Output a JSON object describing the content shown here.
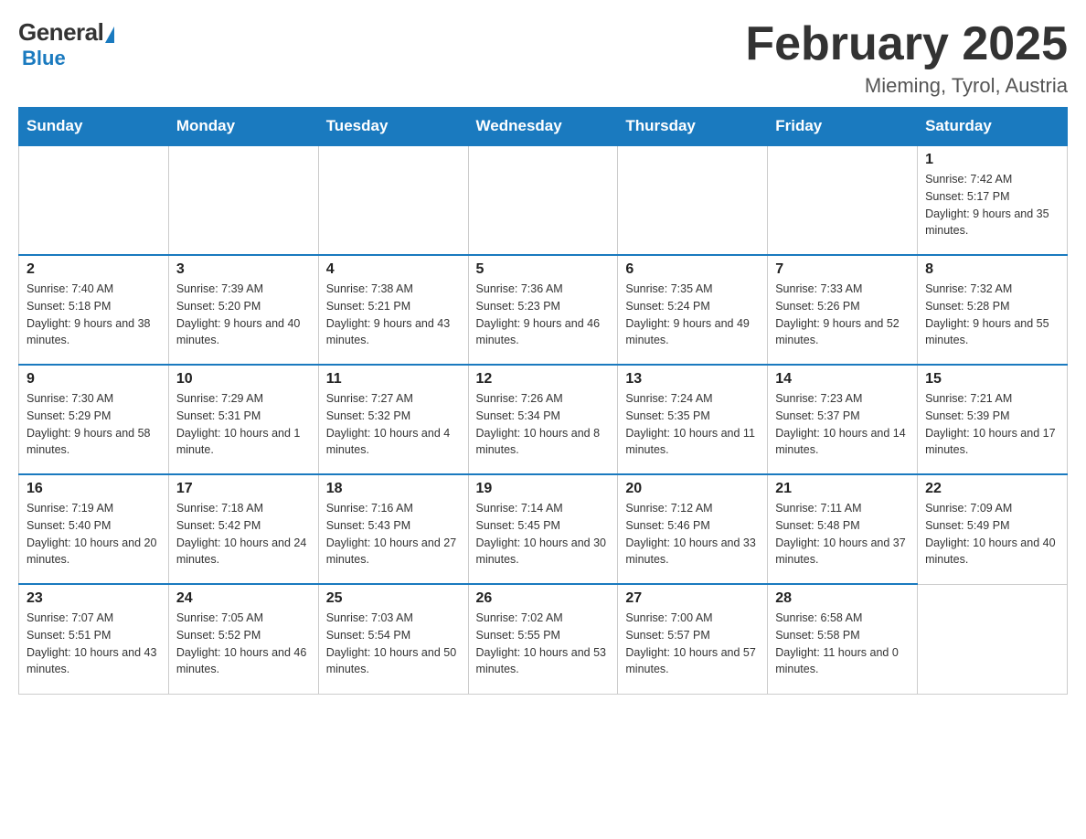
{
  "logo": {
    "general": "General",
    "blue": "Blue"
  },
  "title": "February 2025",
  "subtitle": "Mieming, Tyrol, Austria",
  "days_of_week": [
    "Sunday",
    "Monday",
    "Tuesday",
    "Wednesday",
    "Thursday",
    "Friday",
    "Saturday"
  ],
  "weeks": [
    [
      {
        "day": "",
        "info": ""
      },
      {
        "day": "",
        "info": ""
      },
      {
        "day": "",
        "info": ""
      },
      {
        "day": "",
        "info": ""
      },
      {
        "day": "",
        "info": ""
      },
      {
        "day": "",
        "info": ""
      },
      {
        "day": "1",
        "info": "Sunrise: 7:42 AM\nSunset: 5:17 PM\nDaylight: 9 hours and 35 minutes."
      }
    ],
    [
      {
        "day": "2",
        "info": "Sunrise: 7:40 AM\nSunset: 5:18 PM\nDaylight: 9 hours and 38 minutes."
      },
      {
        "day": "3",
        "info": "Sunrise: 7:39 AM\nSunset: 5:20 PM\nDaylight: 9 hours and 40 minutes."
      },
      {
        "day": "4",
        "info": "Sunrise: 7:38 AM\nSunset: 5:21 PM\nDaylight: 9 hours and 43 minutes."
      },
      {
        "day": "5",
        "info": "Sunrise: 7:36 AM\nSunset: 5:23 PM\nDaylight: 9 hours and 46 minutes."
      },
      {
        "day": "6",
        "info": "Sunrise: 7:35 AM\nSunset: 5:24 PM\nDaylight: 9 hours and 49 minutes."
      },
      {
        "day": "7",
        "info": "Sunrise: 7:33 AM\nSunset: 5:26 PM\nDaylight: 9 hours and 52 minutes."
      },
      {
        "day": "8",
        "info": "Sunrise: 7:32 AM\nSunset: 5:28 PM\nDaylight: 9 hours and 55 minutes."
      }
    ],
    [
      {
        "day": "9",
        "info": "Sunrise: 7:30 AM\nSunset: 5:29 PM\nDaylight: 9 hours and 58 minutes."
      },
      {
        "day": "10",
        "info": "Sunrise: 7:29 AM\nSunset: 5:31 PM\nDaylight: 10 hours and 1 minute."
      },
      {
        "day": "11",
        "info": "Sunrise: 7:27 AM\nSunset: 5:32 PM\nDaylight: 10 hours and 4 minutes."
      },
      {
        "day": "12",
        "info": "Sunrise: 7:26 AM\nSunset: 5:34 PM\nDaylight: 10 hours and 8 minutes."
      },
      {
        "day": "13",
        "info": "Sunrise: 7:24 AM\nSunset: 5:35 PM\nDaylight: 10 hours and 11 minutes."
      },
      {
        "day": "14",
        "info": "Sunrise: 7:23 AM\nSunset: 5:37 PM\nDaylight: 10 hours and 14 minutes."
      },
      {
        "day": "15",
        "info": "Sunrise: 7:21 AM\nSunset: 5:39 PM\nDaylight: 10 hours and 17 minutes."
      }
    ],
    [
      {
        "day": "16",
        "info": "Sunrise: 7:19 AM\nSunset: 5:40 PM\nDaylight: 10 hours and 20 minutes."
      },
      {
        "day": "17",
        "info": "Sunrise: 7:18 AM\nSunset: 5:42 PM\nDaylight: 10 hours and 24 minutes."
      },
      {
        "day": "18",
        "info": "Sunrise: 7:16 AM\nSunset: 5:43 PM\nDaylight: 10 hours and 27 minutes."
      },
      {
        "day": "19",
        "info": "Sunrise: 7:14 AM\nSunset: 5:45 PM\nDaylight: 10 hours and 30 minutes."
      },
      {
        "day": "20",
        "info": "Sunrise: 7:12 AM\nSunset: 5:46 PM\nDaylight: 10 hours and 33 minutes."
      },
      {
        "day": "21",
        "info": "Sunrise: 7:11 AM\nSunset: 5:48 PM\nDaylight: 10 hours and 37 minutes."
      },
      {
        "day": "22",
        "info": "Sunrise: 7:09 AM\nSunset: 5:49 PM\nDaylight: 10 hours and 40 minutes."
      }
    ],
    [
      {
        "day": "23",
        "info": "Sunrise: 7:07 AM\nSunset: 5:51 PM\nDaylight: 10 hours and 43 minutes."
      },
      {
        "day": "24",
        "info": "Sunrise: 7:05 AM\nSunset: 5:52 PM\nDaylight: 10 hours and 46 minutes."
      },
      {
        "day": "25",
        "info": "Sunrise: 7:03 AM\nSunset: 5:54 PM\nDaylight: 10 hours and 50 minutes."
      },
      {
        "day": "26",
        "info": "Sunrise: 7:02 AM\nSunset: 5:55 PM\nDaylight: 10 hours and 53 minutes."
      },
      {
        "day": "27",
        "info": "Sunrise: 7:00 AM\nSunset: 5:57 PM\nDaylight: 10 hours and 57 minutes."
      },
      {
        "day": "28",
        "info": "Sunrise: 6:58 AM\nSunset: 5:58 PM\nDaylight: 11 hours and 0 minutes."
      },
      {
        "day": "",
        "info": ""
      }
    ]
  ]
}
